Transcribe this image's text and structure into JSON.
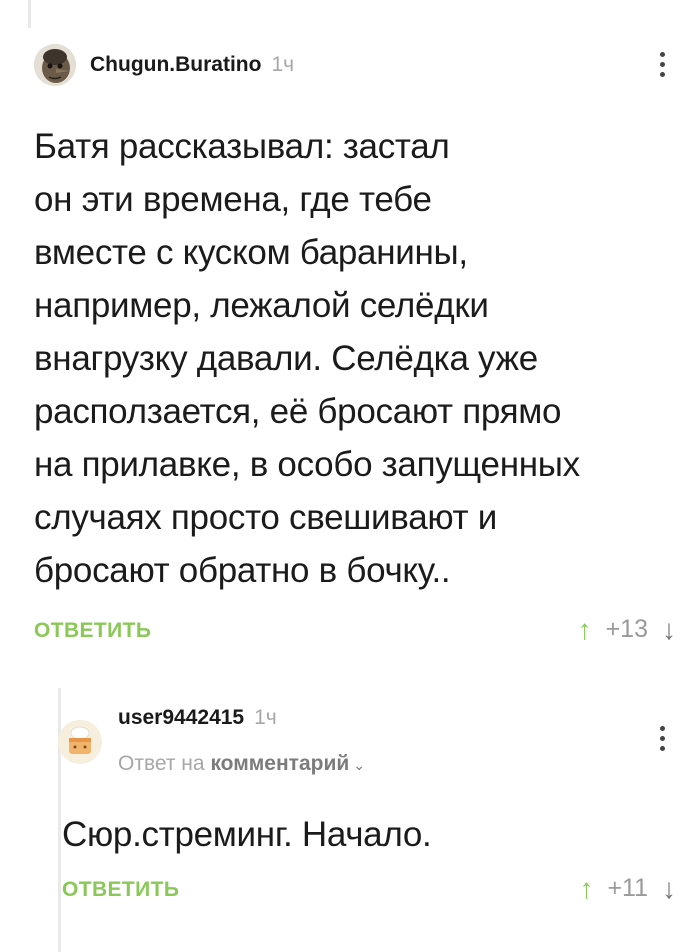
{
  "comment1": {
    "username": "Chugun.Buratino",
    "time": "1ч",
    "text": "Батя рассказывал: застал он эти времена, где тебе вместе с куском баранины, например, лежалой селёдки внагрузку давали. Селёдка уже расползается, её бросают прямо на прилавке, в особо запущенных случаях просто свешивают и бросают обратно в бочку..",
    "lines": [
      "Батя рассказывал: застал",
      "он эти времена, где тебе",
      "вместе с куском баранины,",
      "например, лежалой селёдки",
      "внагрузку давали. Селёдка уже",
      "расползается, её бросают прямо",
      "на прилавке, в особо запущенных",
      "случаях просто свешивают и",
      "бросают обратно в бочку.."
    ],
    "reply_label": "ОТВЕТИТЬ",
    "rating": "+13"
  },
  "comment2": {
    "username": "user9442415",
    "time": "1ч",
    "reply_prefix": "Ответ на",
    "reply_target": "комментарий",
    "text": "Сюр.стреминг. Начало.",
    "reply_label": "ОТВЕТИТЬ",
    "rating": "+11"
  },
  "icons": {
    "vote_up": "arrow-up-icon",
    "vote_down": "arrow-down-icon",
    "menu": "more-vertical-icon",
    "reply_chevron": "chevron-down-icon"
  },
  "colors": {
    "accent_green": "#8ac858",
    "muted_gray": "#a7a7a7"
  }
}
